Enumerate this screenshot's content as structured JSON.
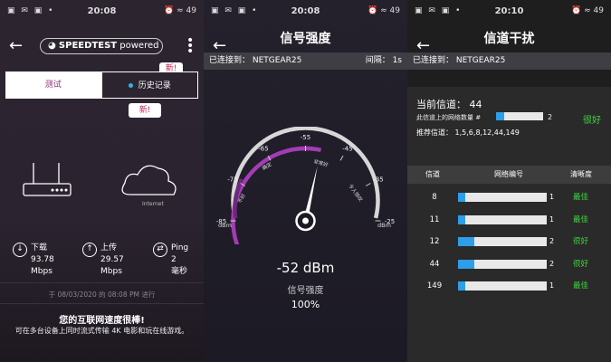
{
  "status_bars": [
    {
      "time": "20:08",
      "left": "▣ ✉ ▣ •",
      "right": "⏰ ≈ 49"
    },
    {
      "time": "20:08",
      "left": "▣ ✉ ▣ •",
      "right": "⏰ ≈ 49"
    },
    {
      "time": "20:10",
      "left": "▣ ✉ ▣ •",
      "right": "⏰ ≈ 49"
    }
  ],
  "panel1": {
    "logo_brand": "SPEEDTEST",
    "logo_suffix": "powered",
    "new_badge_1": "新!",
    "new_badge_2": "新!",
    "tab_test": "测试",
    "tab_history": "历史记录",
    "internet_label": "Internet",
    "download": {
      "label": "下载",
      "value": "93.78",
      "unit": "Mbps"
    },
    "upload": {
      "label": "上传",
      "value": "29.57",
      "unit": "Mbps"
    },
    "ping": {
      "label": "Ping",
      "value": "2",
      "unit": "毫秒"
    },
    "timestamp": "于 08/03/2020 的 08:08 PM 进行",
    "result_title": "您的互联网速度很棒!",
    "result_sub": "可在多台设备上同时流式传输 4K 电影和玩在线游戏。"
  },
  "panel2": {
    "title": "信号强度",
    "connected": "已连接到： NETGEAR25",
    "interval": "间隔： 1s",
    "gauge_ticks": [
      "-95",
      "-85",
      "-75",
      "-65",
      "-55",
      "-45",
      "-35",
      "-25",
      "-17"
    ],
    "gauge_unit_left": "dBm",
    "gauge_unit_right": "dBm",
    "zone_labels": [
      "不好",
      "确定",
      "非常好",
      "令人惊叹"
    ],
    "value": "-52 dBm",
    "value_number": -52,
    "label": "信号强度",
    "percent": "100%"
  },
  "panel3": {
    "title": "信道干扰",
    "connected": "已连接到： NETGEAR25",
    "current_channel": "当前信道： 44",
    "net_count_label": "此信道上的网络数量 #",
    "net_count": "2",
    "net_count_level": 0.18,
    "current_quality": "很好",
    "recommended": "推荐信道： 1,5,6,8,12,44,149",
    "table_headers": [
      "信道",
      "网络编号",
      "清晰度"
    ],
    "rows": [
      {
        "channel": "8",
        "count": "1",
        "level": 0.08,
        "quality": "最佳"
      },
      {
        "channel": "11",
        "count": "1",
        "level": 0.08,
        "quality": "最佳"
      },
      {
        "channel": "12",
        "count": "2",
        "level": 0.18,
        "quality": "很好"
      },
      {
        "channel": "44",
        "count": "2",
        "level": 0.18,
        "quality": "很好"
      },
      {
        "channel": "149",
        "count": "1",
        "level": 0.08,
        "quality": "最佳"
      }
    ]
  },
  "colors": {
    "accent_purple": "#8a2d79",
    "gauge_purple": "#b13fc4",
    "good_green": "#3fd33f",
    "bar_blue": "#2e9ee8"
  }
}
